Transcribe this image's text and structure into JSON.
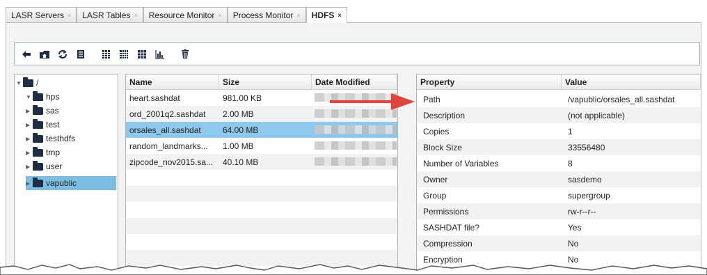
{
  "tabs": [
    {
      "label": "LASR Servers",
      "close": "×",
      "active": false
    },
    {
      "label": "LASR Tables",
      "close": "×",
      "active": false
    },
    {
      "label": "Resource Monitor",
      "close": "×",
      "active": false
    },
    {
      "label": "Process Monitor",
      "close": "×",
      "active": false
    },
    {
      "label": "HDFS",
      "close": "×",
      "active": true
    }
  ],
  "toolbar": {
    "icons": [
      "back-arrow-icon",
      "home-folder-icon",
      "refresh-icon",
      "properties-icon",
      "column-view-icon",
      "grid-view-icon",
      "table-view-icon",
      "chart-icon",
      "delete-icon"
    ]
  },
  "tree": {
    "root": "/",
    "items": [
      {
        "label": "hps",
        "expanded": true
      },
      {
        "label": "sas",
        "expanded": false
      },
      {
        "label": "test",
        "expanded": false
      },
      {
        "label": "testhdfs",
        "expanded": false
      },
      {
        "label": "tmp",
        "expanded": false
      },
      {
        "label": "user",
        "expanded": false
      },
      {
        "label": "vapublic",
        "expanded": false,
        "selected": true
      }
    ]
  },
  "files": {
    "headers": {
      "name": "Name",
      "size": "Size",
      "date": "Date Modified"
    },
    "rows": [
      {
        "name": "heart.sashdat",
        "size": "981.00 KB"
      },
      {
        "name": "ord_2001q2.sashdat",
        "size": "2.00 MB"
      },
      {
        "name": "orsales_all.sashdat",
        "size": "64.00 MB",
        "selected": true
      },
      {
        "name": "random_landmarks...",
        "size": "1.00 MB"
      },
      {
        "name": "zipcode_nov2015.sa...",
        "size": "40.10 MB"
      }
    ]
  },
  "properties": {
    "headers": {
      "property": "Property",
      "value": "Value"
    },
    "rows": [
      {
        "property": "Path",
        "value": "/vapublic/orsales_all.sashdat"
      },
      {
        "property": "Description",
        "value": "(not applicable)"
      },
      {
        "property": "Copies",
        "value": "1"
      },
      {
        "property": "Block Size",
        "value": "33556480"
      },
      {
        "property": "Number of Variables",
        "value": "8"
      },
      {
        "property": "Owner",
        "value": "sasdemo"
      },
      {
        "property": "Group",
        "value": "supergroup"
      },
      {
        "property": "Permissions",
        "value": "rw-r--r--"
      },
      {
        "property": "SASHDAT file?",
        "value": "Yes"
      },
      {
        "property": "Compression",
        "value": "No"
      },
      {
        "property": "Encryption",
        "value": "No"
      }
    ]
  },
  "colors": {
    "selection": "#8ec8ea",
    "folder": "#1d2e45",
    "arrow": "#e0443a"
  }
}
